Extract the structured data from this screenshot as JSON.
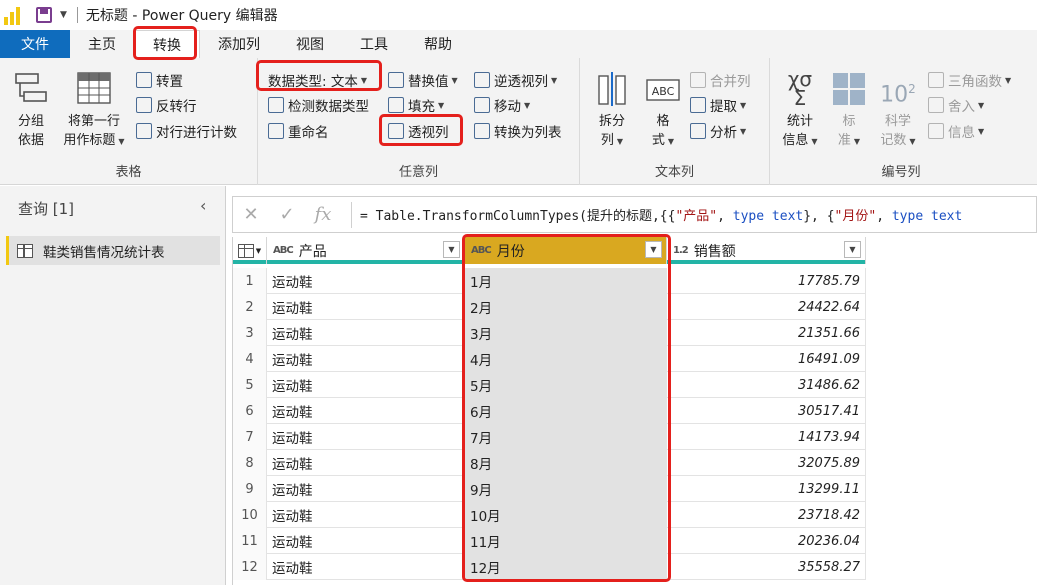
{
  "window": {
    "title": "无标题 - Power Query 编辑器"
  },
  "tabs": [
    {
      "label": "文件"
    },
    {
      "label": "主页"
    },
    {
      "label": "转换"
    },
    {
      "label": "添加列"
    },
    {
      "label": "视图"
    },
    {
      "label": "工具"
    },
    {
      "label": "帮助"
    }
  ],
  "ribbon": {
    "table_group": {
      "label": "表格",
      "group_by": [
        "分组",
        "依据"
      ],
      "first_row_header": [
        "将第一行",
        "用作标题"
      ],
      "transpose": "转置",
      "reverse_rows": "反转行",
      "count_rows": "对行进行计数"
    },
    "any_column_group": {
      "label": "任意列",
      "data_type": "数据类型: 文本",
      "detect_type": "检测数据类型",
      "rename": "重命名",
      "replace_values": "替换值",
      "fill": "填充",
      "pivot_column": "透视列",
      "unpivot_columns": "逆透视列",
      "move": "移动",
      "convert_to_list": "转换为列表"
    },
    "text_column_group": {
      "label": "文本列",
      "split_column": [
        "拆分",
        "列"
      ],
      "format": [
        "格",
        "式"
      ],
      "merge_columns": "合并列",
      "extract": "提取",
      "parse": "分析"
    },
    "number_column_group": {
      "label": "编号列",
      "statistics": [
        "统计",
        "信息"
      ],
      "standard": [
        "标",
        "准"
      ],
      "scientific": [
        "科学",
        "记数"
      ],
      "trigonometry": "三角函数",
      "rounding": "舍入",
      "information": "信息"
    }
  },
  "queries_pane": {
    "header": "查询 [1]",
    "items": [
      {
        "label": "鞋类销售情况统计表"
      }
    ]
  },
  "formula_bar": {
    "prefix": "= Table.TransformColumnTypes(提升的标题,{{",
    "s1": "\"产品\"",
    "m1": ", ",
    "k1": "type text",
    "m2": "}, {",
    "s2": "\"月份\"",
    "m3": ", ",
    "k2": "type text"
  },
  "grid": {
    "columns": [
      {
        "name": "产品",
        "type_glyph": "ABC"
      },
      {
        "name": "月份",
        "type_glyph": "ABC"
      },
      {
        "name": "销售额",
        "type_glyph": "1.2"
      }
    ],
    "rows": [
      {
        "index": "1",
        "product": "运动鞋",
        "month": "1月",
        "sales": "17785.79"
      },
      {
        "index": "2",
        "product": "运动鞋",
        "month": "2月",
        "sales": "24422.64"
      },
      {
        "index": "3",
        "product": "运动鞋",
        "month": "3月",
        "sales": "21351.66"
      },
      {
        "index": "4",
        "product": "运动鞋",
        "month": "4月",
        "sales": "16491.09"
      },
      {
        "index": "5",
        "product": "运动鞋",
        "month": "5月",
        "sales": "31486.62"
      },
      {
        "index": "6",
        "product": "运动鞋",
        "month": "6月",
        "sales": "30517.41"
      },
      {
        "index": "7",
        "product": "运动鞋",
        "month": "7月",
        "sales": "14173.94"
      },
      {
        "index": "8",
        "product": "运动鞋",
        "month": "8月",
        "sales": "32075.89"
      },
      {
        "index": "9",
        "product": "运动鞋",
        "month": "9月",
        "sales": "13299.11"
      },
      {
        "index": "10",
        "product": "运动鞋",
        "month": "10月",
        "sales": "23718.42"
      },
      {
        "index": "11",
        "product": "运动鞋",
        "month": "11月",
        "sales": "20236.04"
      },
      {
        "index": "12",
        "product": "运动鞋",
        "month": "12月",
        "sales": "35558.27"
      }
    ]
  },
  "colors": {
    "file_tab": "#0f6cbd",
    "highlight_box": "#e4201c",
    "selected_column": "#d9a820",
    "header_underline": "#23b4a6"
  }
}
